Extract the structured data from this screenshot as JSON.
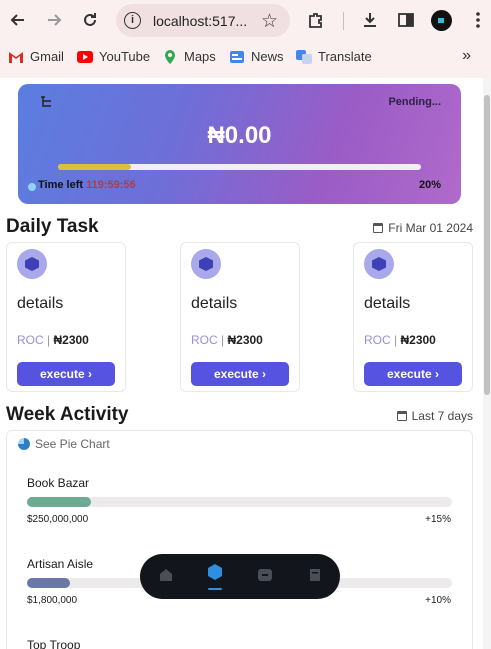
{
  "browser": {
    "url_text": "localhost:517...",
    "bookmarks": [
      "Gmail",
      "YouTube",
      "Maps",
      "News",
      "Translate"
    ]
  },
  "hero": {
    "status": "Pending...",
    "amount": "₦0.00",
    "progress_fraction": 0.2,
    "time_left_label": "Time left",
    "time_left_value": "119:59:56",
    "percent_label": "20%"
  },
  "daily_task": {
    "title": "Daily Task",
    "date": "Fri Mar 01 2024",
    "cards": [
      {
        "label": "details",
        "token": "ROC",
        "price": "₦2300",
        "button": "execute"
      },
      {
        "label": "details",
        "token": "ROC",
        "price": "₦2300",
        "button": "execute"
      },
      {
        "label": "details",
        "token": "ROC",
        "price": "₦2300",
        "button": "execute"
      }
    ]
  },
  "week_activity": {
    "title": "Week Activity",
    "range": "Last 7 days",
    "pie_link": "See Pie Chart",
    "items": [
      {
        "name": "Book Bazar",
        "value": "$250,000,000",
        "change": "+15%",
        "fraction": 0.15,
        "color": "#6aab92"
      },
      {
        "name": "Artisan Aisle",
        "value": "$1,800,000",
        "change": "+10%",
        "fraction": 0.1,
        "color": "#6a78a8"
      },
      {
        "name": "Top Troop",
        "value": "",
        "change": "",
        "fraction": 0,
        "color": "#cccccc"
      }
    ]
  },
  "colors": {
    "accent": "#5553e0",
    "hero_start": "#5b7ee0",
    "hero_end": "#b06acb",
    "progress": "#d8c23a"
  },
  "dock": {
    "items": [
      "home-icon",
      "cube-icon",
      "wallet-icon",
      "document-icon"
    ],
    "active": 1
  }
}
